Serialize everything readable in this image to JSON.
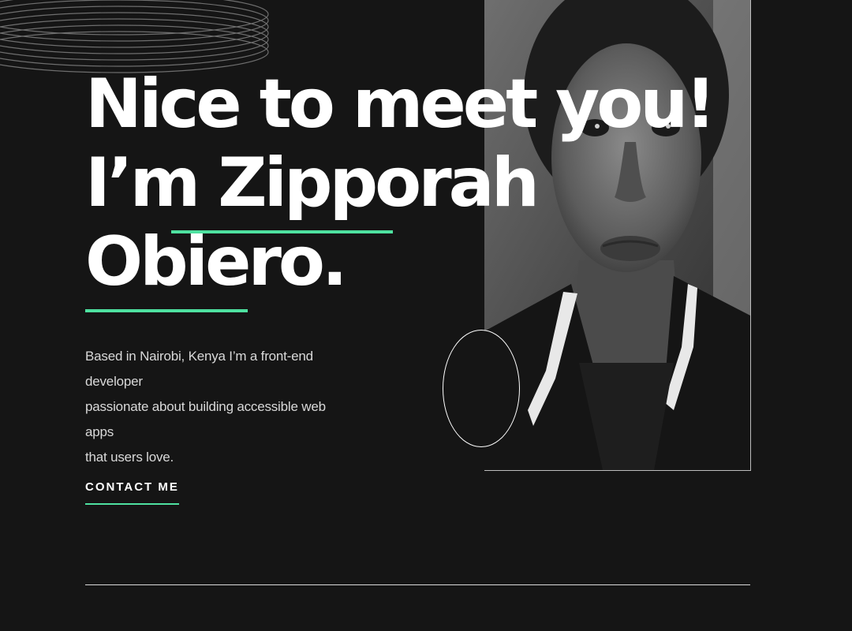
{
  "hero": {
    "headline_line1": "Nice to meet you!",
    "headline_line2": "I’m Zipporah",
    "headline_line3": "Obiero.",
    "bio_line1": "Based in Nairobi, Kenya I’m a front-end developer",
    "bio_line2": "passionate about building accessible web apps",
    "bio_line3": "that users love.",
    "contact_label": "CONTACT ME",
    "portrait_alt": "Portrait of Zipporah Obiero"
  },
  "colors": {
    "background": "#151515",
    "accent": "#4ee1a0",
    "text": "#ffffff",
    "muted_text": "#d9d9d9"
  }
}
